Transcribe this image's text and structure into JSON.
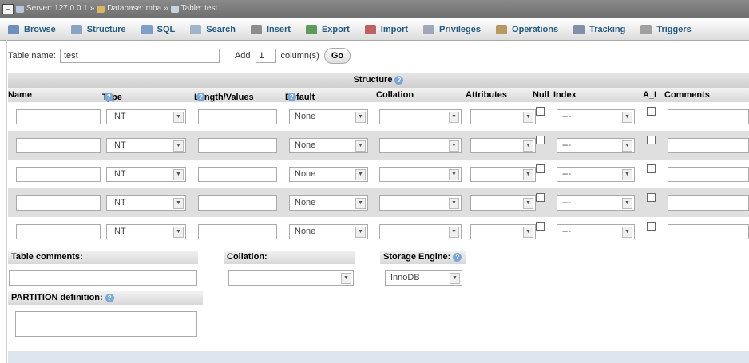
{
  "breadcrumb": {
    "server": "Server: 127.0.0.1",
    "database": "Database: mba",
    "table": "Table: test",
    "separator": "»"
  },
  "tabs": [
    {
      "label": "Browse",
      "icon": "browse-icon",
      "color": "#6d8fb8"
    },
    {
      "label": "Structure",
      "icon": "structure-icon",
      "color": "#8aa5c4"
    },
    {
      "label": "SQL",
      "icon": "sql-icon",
      "color": "#7d9fc6"
    },
    {
      "label": "Search",
      "icon": "search-icon",
      "color": "#9fb3c9"
    },
    {
      "label": "Insert",
      "icon": "insert-icon",
      "color": "#8c8c8c"
    },
    {
      "label": "Export",
      "icon": "export-icon",
      "color": "#5c9a5c"
    },
    {
      "label": "Import",
      "icon": "import-icon",
      "color": "#c06060"
    },
    {
      "label": "Privileges",
      "icon": "privileges-icon",
      "color": "#a0a8b8"
    },
    {
      "label": "Operations",
      "icon": "operations-icon",
      "color": "#b89860"
    },
    {
      "label": "Tracking",
      "icon": "tracking-icon",
      "color": "#8090a8"
    },
    {
      "label": "Triggers",
      "icon": "triggers-icon",
      "color": "#a0a0a0"
    }
  ],
  "name_row": {
    "table_name_label": "Table name:",
    "table_name_value": "test",
    "add_label": "Add",
    "add_count": "1",
    "columns_label": "column(s)",
    "go_label": "Go"
  },
  "structure": {
    "title": "Structure",
    "headers": {
      "name": "Name",
      "type": "Type",
      "length": "Length/Values",
      "default": "Default",
      "collation": "Collation",
      "attributes": "Attributes",
      "null": "Null",
      "index": "Index",
      "ai": "A_I",
      "comments": "Comments"
    },
    "rows": [
      {
        "type": "INT",
        "default": "None",
        "index": "---"
      },
      {
        "type": "INT",
        "default": "None",
        "index": "---"
      },
      {
        "type": "INT",
        "default": "None",
        "index": "---"
      },
      {
        "type": "INT",
        "default": "None",
        "index": "---"
      },
      {
        "type": "INT",
        "default": "None",
        "index": "---"
      }
    ]
  },
  "bottom": {
    "table_comments_label": "Table comments:",
    "collation_label": "Collation:",
    "storage_engine_label": "Storage Engine:",
    "storage_engine_value": "InnoDB",
    "partition_label": "PARTITION definition:"
  }
}
